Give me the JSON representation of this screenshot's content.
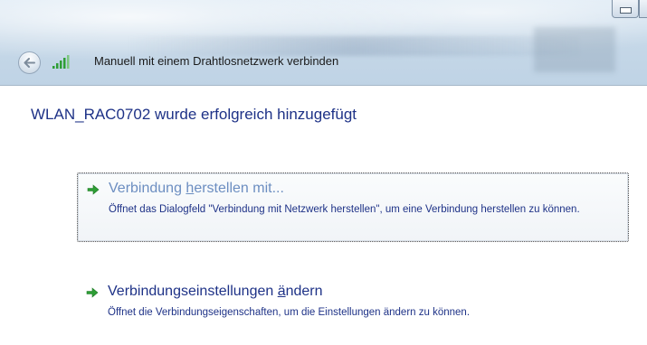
{
  "window": {
    "title": "Manuell mit einem Drahtlosnetzwerk verbinden",
    "icons": {
      "back": "back-arrow-icon",
      "network": "wireless-signal-icon"
    }
  },
  "main": {
    "heading": "WLAN_RAC0702 wurde erfolgreich hinzugefügt",
    "options": [
      {
        "title_before": "Verbindung ",
        "title_accel": "h",
        "title_after": "erstellen mit...",
        "description": "Öffnet das Dialogfeld \"Verbindung mit Netzwerk herstellen\", um eine Verbindung herstellen zu können.",
        "icon": "green-arrow-icon",
        "focused": true
      },
      {
        "title_before": "Verbindungseinstellungen ",
        "title_accel": "ä",
        "title_after": "ndern",
        "description": "Öffnet die Verbindungseigenschaften, um die Einstellungen ändern zu können.",
        "icon": "green-arrow-icon",
        "focused": false
      }
    ]
  },
  "colors": {
    "heading": "#1e3287",
    "link_focused": "#6c8ec1",
    "link": "#1e3287",
    "arrow": "#2e9e35"
  }
}
